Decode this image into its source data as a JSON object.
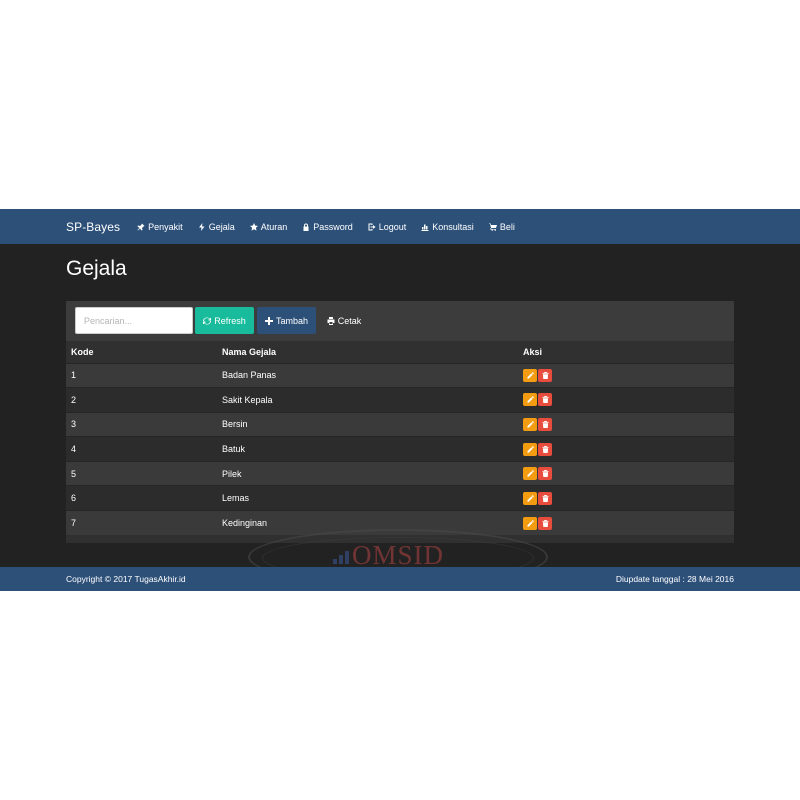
{
  "navbar": {
    "brand": "SP-Bayes",
    "items": [
      {
        "label": "Penyakit",
        "icon": "pushpin-icon"
      },
      {
        "label": "Gejala",
        "icon": "bolt-icon"
      },
      {
        "label": "Aturan",
        "icon": "star-icon"
      },
      {
        "label": "Password",
        "icon": "lock-icon"
      },
      {
        "label": "Logout",
        "icon": "logout-icon"
      },
      {
        "label": "Konsultasi",
        "icon": "bar-chart-icon"
      },
      {
        "label": "Beli",
        "icon": "shopping-cart-icon"
      }
    ]
  },
  "page": {
    "title": "Gejala"
  },
  "toolbar": {
    "search_placeholder": "Pencarian...",
    "search_value": "",
    "refresh_label": "Refresh",
    "tambah_label": "Tambah",
    "cetak_label": "Cetak"
  },
  "table": {
    "headers": {
      "kode": "Kode",
      "nama": "Nama Gejala",
      "aksi": "Aksi"
    },
    "rows": [
      {
        "kode": "1",
        "nama": "Badan Panas"
      },
      {
        "kode": "2",
        "nama": "Sakit Kepala"
      },
      {
        "kode": "3",
        "nama": "Bersin"
      },
      {
        "kode": "4",
        "nama": "Batuk"
      },
      {
        "kode": "5",
        "nama": "Pilek"
      },
      {
        "kode": "6",
        "nama": "Lemas"
      },
      {
        "kode": "7",
        "nama": "Kedinginan"
      }
    ]
  },
  "watermark": {
    "text": "OMSID"
  },
  "footer": {
    "copyright": "Copyright © 2017 TugasAkhir.id",
    "updated": "Diupdate tanggal : 28 Mei 2016"
  },
  "colors": {
    "navbar": "#2d5079",
    "body": "#222222",
    "refresh": "#18bc9c",
    "tambah": "#2d5079",
    "edit": "#f39c12",
    "delete": "#e74c3c"
  }
}
